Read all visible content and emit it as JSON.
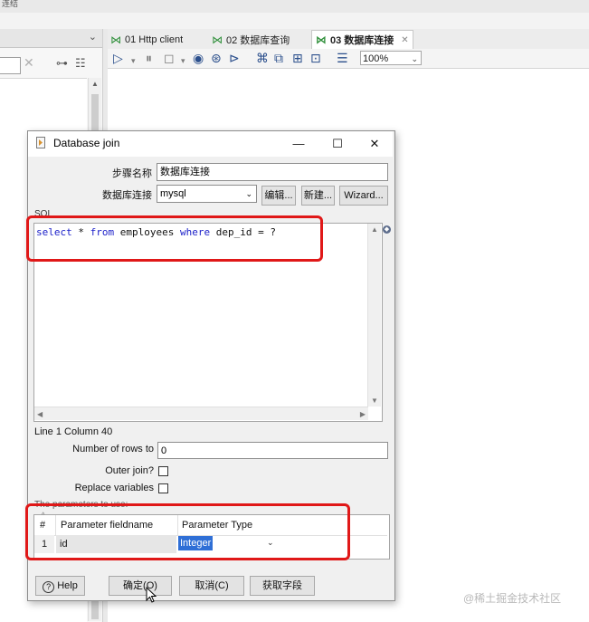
{
  "app": {
    "top_strip_text": "连结",
    "editor_tabs": [
      {
        "label": "01 Http client"
      },
      {
        "label": "02 数据库查询"
      },
      {
        "label": "03 数据库连接",
        "close": "✕"
      }
    ],
    "zoom": "100%",
    "left_clear_icon": "✕"
  },
  "dialog": {
    "title": "Database join",
    "window_buttons": {
      "minimize": "—",
      "maximize": "☐",
      "close": "✕"
    },
    "step_name_label": "步骤名称",
    "step_name_value": "数据库连接",
    "connection_label": "数据库连接",
    "connection_value": "mysql",
    "edit_button": "编辑...",
    "new_button": "新建...",
    "wizard_button": "Wizard...",
    "sql_label": "SQL",
    "sql_tokens": [
      {
        "text": "select",
        "kw": true
      },
      {
        "text": " * ",
        "kw": false
      },
      {
        "text": "from",
        "kw": true
      },
      {
        "text": " employees ",
        "kw": false
      },
      {
        "text": "where",
        "kw": true
      },
      {
        "text": " dep_id = ?",
        "kw": false
      }
    ],
    "line_column": "Line 1 Column 40",
    "rows_label": "Number of rows to",
    "rows_value": "0",
    "outer_join_label": "Outer join?",
    "replace_vars_label": "Replace variables",
    "params_label": "The parameters to use:",
    "params_table": {
      "columns": [
        "#",
        "Parameter fieldname",
        "Parameter Type"
      ],
      "rows": [
        [
          "1",
          "id",
          "Integer"
        ]
      ]
    },
    "help_button": "Help",
    "ok_button": "确定(O)",
    "cancel_button": "取消(C)",
    "get_fields_button": "获取字段"
  },
  "watermark": "@稀土掘金技术社区",
  "colors": {
    "highlight": "#e01818",
    "keyword": "#1c20c9",
    "selection": "#2f6fd6"
  }
}
